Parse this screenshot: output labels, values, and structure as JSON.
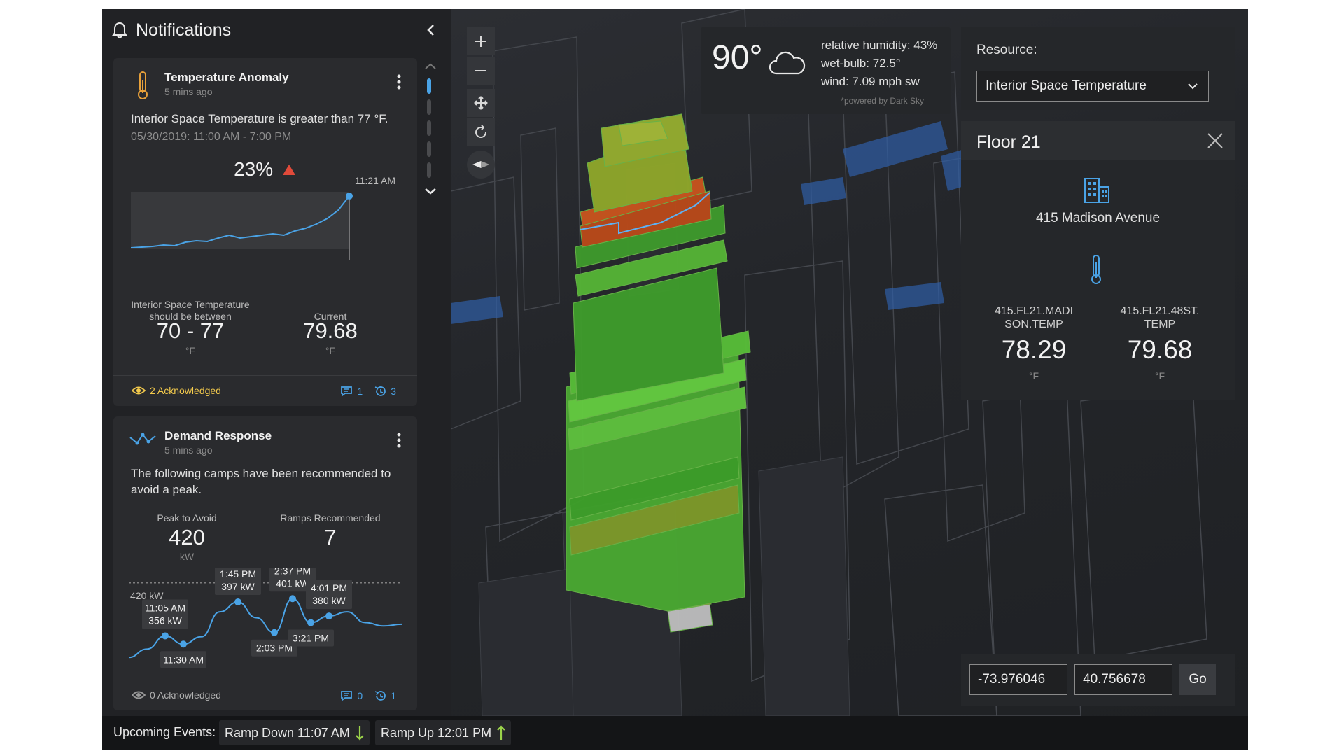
{
  "notifications": {
    "title": "Notifications",
    "cards": [
      {
        "title": "Temperature Anomaly",
        "time": "5 mins ago",
        "description": "Interior Space Temperature is greater than 77 °F.",
        "range": "05/30/2019: 11:00 AM - 7:00 PM",
        "percent": "23%",
        "chart_time": "11:21 AM",
        "threshold_label": "Interior Space Temperature should be between",
        "threshold_value": "70 - 77",
        "threshold_unit": "°F",
        "current_label": "Current",
        "current_value": "79.68",
        "current_unit": "°F",
        "acknowledged": "2 Acknowledged",
        "comments": "1",
        "history": "3"
      },
      {
        "title": "Demand Response",
        "time": "5 mins ago",
        "description": "The following camps have been recommended to avoid a peak.",
        "peak_label": "Peak to Avoid",
        "peak_value": "420",
        "peak_unit": "kW",
        "ramps_label": "Ramps Recommended",
        "ramps_value": "7",
        "line_label": "420 kW",
        "acknowledged": "0 Acknowledged",
        "comments": "0",
        "history": "1"
      }
    ]
  },
  "chart_data": [
    {
      "type": "line",
      "title": "",
      "x": [
        0,
        1,
        2,
        3,
        4,
        5,
        6,
        7,
        8,
        9,
        10,
        11,
        12,
        13,
        14,
        15,
        16,
        17,
        18,
        19,
        20
      ],
      "values": [
        3,
        3.5,
        4,
        5,
        4.5,
        7,
        8,
        7.5,
        10,
        12,
        10,
        11,
        12,
        13,
        12,
        15,
        17,
        20,
        24,
        30,
        40
      ],
      "ylim": [
        0,
        45
      ],
      "annotation": "11:21 AM"
    },
    {
      "type": "line",
      "title": "",
      "x": [
        0,
        1,
        2,
        3,
        4,
        5,
        6,
        7,
        8,
        9,
        10,
        11,
        12,
        13,
        14,
        15
      ],
      "values": [
        330,
        340,
        356,
        346,
        355,
        385,
        397,
        378,
        360,
        401,
        372,
        380,
        385,
        372,
        368,
        370
      ],
      "ylim": [
        320,
        430
      ],
      "reference_line": 420,
      "labels": [
        {
          "time": "11:05 AM",
          "value": "356 kW",
          "index": 2
        },
        {
          "time": "11:30 AM",
          "value": "",
          "index": 3
        },
        {
          "time": "1:45 PM",
          "value": "397 kW",
          "index": 6
        },
        {
          "time": "2:03 PM",
          "value": "",
          "index": 8
        },
        {
          "time": "2:37 PM",
          "value": "401 kW",
          "index": 9
        },
        {
          "time": "3:21 PM",
          "value": "",
          "index": 10
        },
        {
          "time": "4:01 PM",
          "value": "380 kW",
          "index": 11
        }
      ]
    }
  ],
  "weather": {
    "temp": "90°",
    "humidity": "relative humidity: 43%",
    "wetbulb": "wet-bulb: 72.5°",
    "wind": "wind: 7.09 mph sw",
    "powered": "*powered by Dark Sky"
  },
  "resource": {
    "label": "Resource:",
    "selected": "Interior Space Temperature"
  },
  "floor": {
    "title": "Floor 21",
    "address": "415 Madison Avenue",
    "sensors": [
      {
        "label": "415.FL21.MADI SON.TEMP",
        "value": "78.29",
        "unit": "°F"
      },
      {
        "label": "415.FL21.48ST. TEMP",
        "value": "79.68",
        "unit": "°F"
      }
    ]
  },
  "coords": {
    "lng": "-73.976046",
    "lat": "40.756678",
    "go": "Go"
  },
  "events": {
    "label": "Upcoming Events:",
    "items": [
      {
        "label": "Ramp Down 11:07 AM",
        "direction": "down"
      },
      {
        "label": "Ramp Up 12:01 PM",
        "direction": "up"
      }
    ]
  },
  "colors": {
    "accent": "#4aa3e6",
    "ack": "#f2c94c",
    "warning": "#e04a3a",
    "ramp_arrow": "#9bd34a"
  }
}
